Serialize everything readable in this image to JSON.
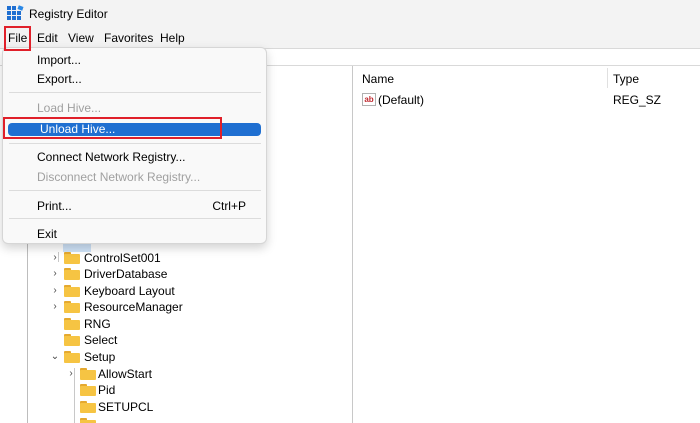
{
  "window": {
    "title": "Registry Editor",
    "app_icon": "registry-editor-icon"
  },
  "menubar": {
    "items": [
      "File",
      "Edit",
      "View",
      "Favorites",
      "Help"
    ]
  },
  "file_menu": {
    "items": [
      {
        "label": "Import...",
        "enabled": true
      },
      {
        "label": "Export...",
        "enabled": true
      },
      {
        "label": "Load Hive...",
        "enabled": false
      },
      {
        "label": "Unload Hive...",
        "enabled": true,
        "selected": true
      },
      {
        "label": "Connect Network Registry...",
        "enabled": true
      },
      {
        "label": "Disconnect Network Registry...",
        "enabled": false
      },
      {
        "label": "Print...",
        "enabled": true,
        "shortcut": "Ctrl+P"
      },
      {
        "label": "Exit",
        "enabled": true
      }
    ]
  },
  "values_pane": {
    "columns": [
      "Name",
      "Type"
    ],
    "rows": [
      {
        "name": "(Default)",
        "type": "REG_SZ",
        "icon": "string-value-icon"
      }
    ]
  },
  "tree": {
    "items": [
      {
        "label": "ControlSet001",
        "expander": "collapsed"
      },
      {
        "label": "DriverDatabase",
        "expander": "collapsed"
      },
      {
        "label": "Keyboard Layout",
        "expander": "collapsed"
      },
      {
        "label": "ResourceManager",
        "expander": "collapsed"
      },
      {
        "label": "RNG",
        "expander": "none"
      },
      {
        "label": "Select",
        "expander": "none"
      },
      {
        "label": "Setup",
        "expander": "expanded"
      },
      {
        "label": "AllowStart",
        "expander": "collapsed"
      },
      {
        "label": "Pid",
        "expander": "none"
      },
      {
        "label": "SETUPCL",
        "expander": "none"
      }
    ]
  },
  "colors": {
    "highlight": "#e0202a",
    "selection": "#1f6fd1",
    "folder": "#f6c443"
  }
}
